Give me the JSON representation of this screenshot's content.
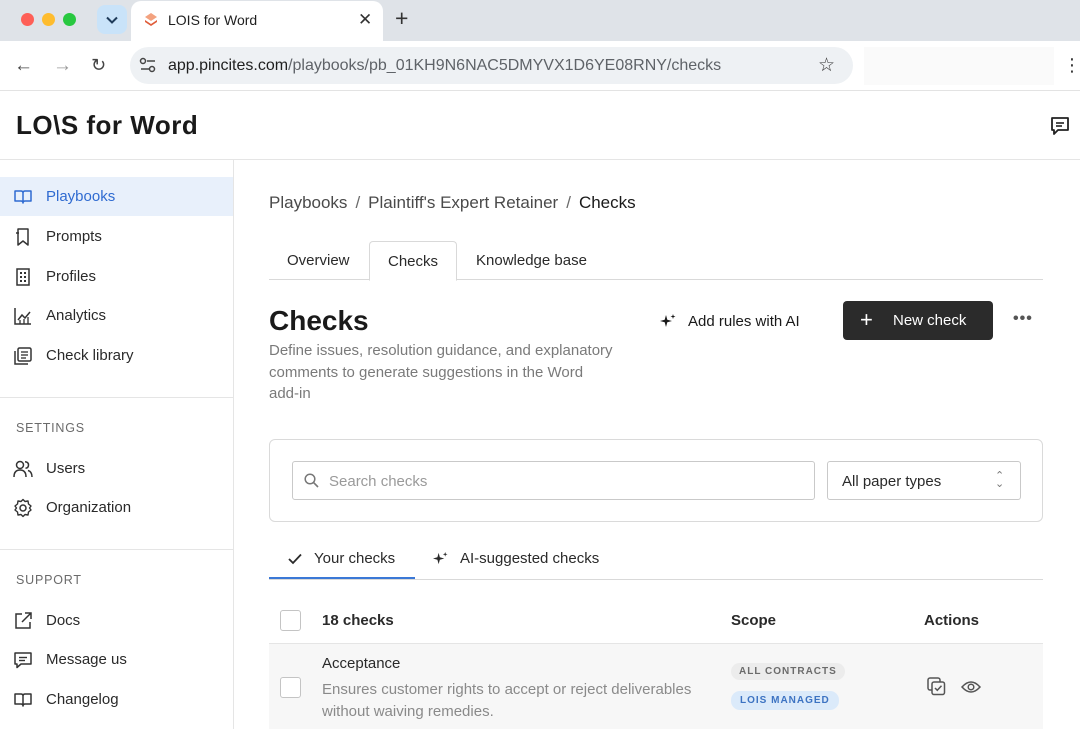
{
  "browser": {
    "tab_title": "LOIS for Word",
    "url_host": "app.pincites.com",
    "url_path": "/playbooks/pb_01KH9N6NAC5DMYVX1D6YE08RNY/checks"
  },
  "app": {
    "logo": "LO\\S for Word"
  },
  "sidebar": {
    "items": [
      {
        "label": "Playbooks",
        "icon": "book-open-icon"
      },
      {
        "label": "Prompts",
        "icon": "bookmark-icon"
      },
      {
        "label": "Profiles",
        "icon": "building-icon"
      },
      {
        "label": "Analytics",
        "icon": "chart-icon"
      },
      {
        "label": "Check library",
        "icon": "library-icon"
      }
    ],
    "settings_heading": "SETTINGS",
    "settings_items": [
      {
        "label": "Users",
        "icon": "users-icon"
      },
      {
        "label": "Organization",
        "icon": "gear-icon"
      }
    ],
    "support_heading": "SUPPORT",
    "support_items": [
      {
        "label": "Docs",
        "icon": "external-link-icon"
      },
      {
        "label": "Message us",
        "icon": "message-icon"
      },
      {
        "label": "Changelog",
        "icon": "book-icon"
      }
    ]
  },
  "breadcrumb": {
    "items": [
      "Playbooks",
      "Plaintiff's Expert Retainer",
      "Checks"
    ],
    "separator": "/"
  },
  "page_tabs": [
    "Overview",
    "Checks",
    "Knowledge base"
  ],
  "header": {
    "title": "Checks",
    "description": "Define issues, resolution guidance, and explanatory comments to generate suggestions in the Word add-in",
    "ai_button": "Add rules with AI",
    "new_button": "New check",
    "more": "•••"
  },
  "filters": {
    "search_placeholder": "Search checks",
    "paper_type": "All paper types"
  },
  "subtabs": [
    "Your checks",
    "AI-suggested checks"
  ],
  "table": {
    "count_label": "18 checks",
    "scope_header": "Scope",
    "actions_header": "Actions",
    "rows": [
      {
        "title": "Acceptance",
        "description": "Ensures customer rights to accept or reject deliverables without waiving remedies.",
        "scope": "ALL CONTRACTS",
        "managed": "LOIS MANAGED"
      }
    ]
  },
  "colors": {
    "accent": "#2f6bd1",
    "active_bg": "#e8f0fb",
    "primary_button": "#2b2b2b"
  }
}
